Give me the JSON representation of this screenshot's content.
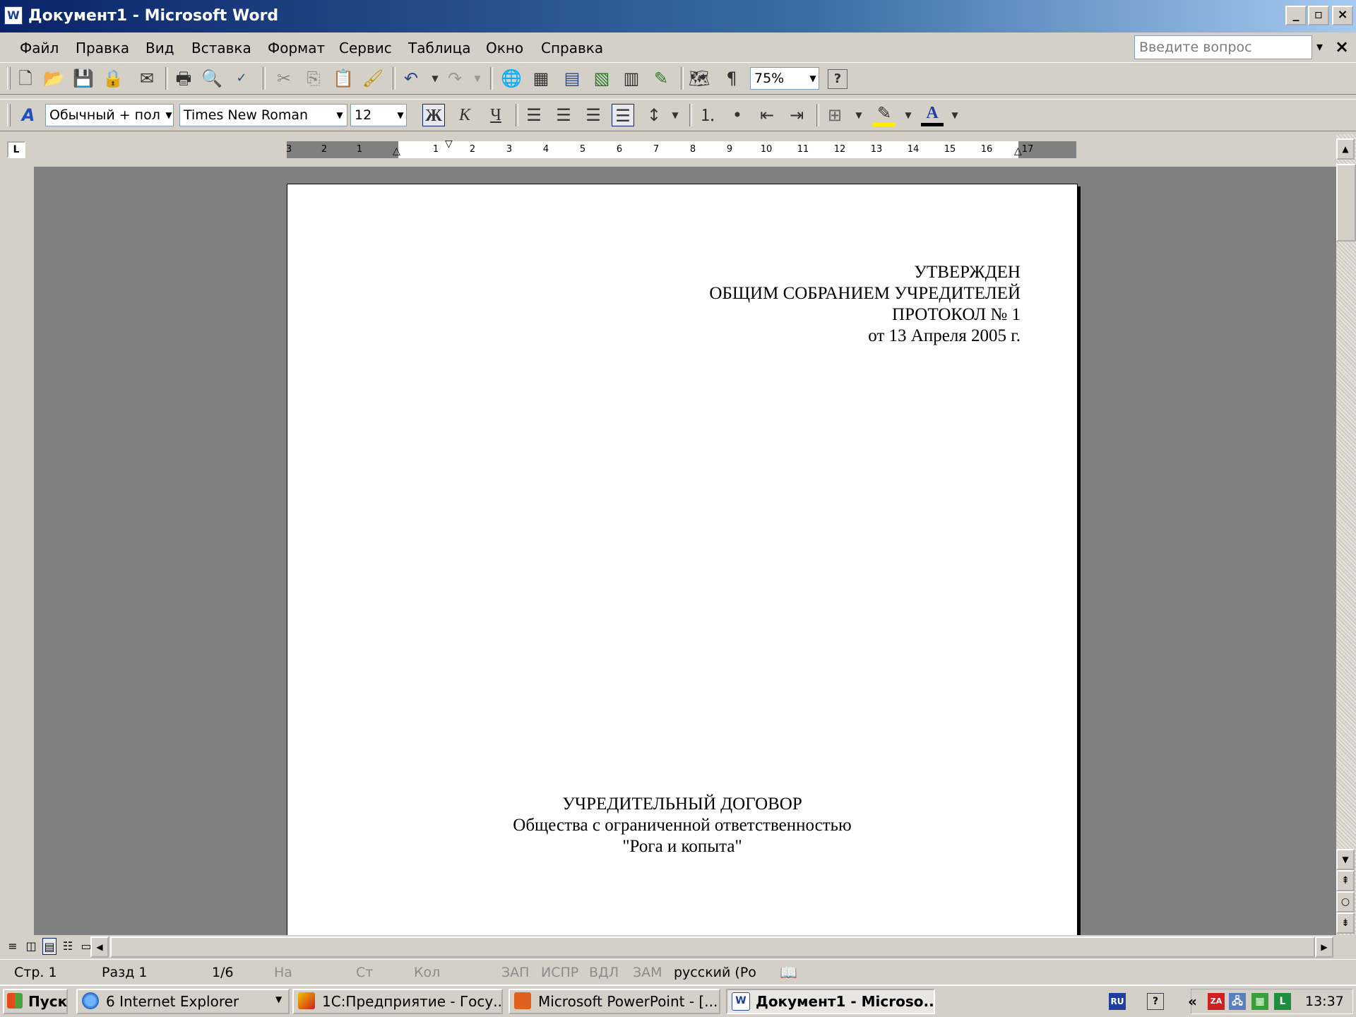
{
  "window": {
    "title": "Документ1 - Microsoft Word",
    "app_icon": "W",
    "controls": [
      "_",
      "▫",
      "×"
    ]
  },
  "menubar": {
    "items": [
      "Файл",
      "Правка",
      "Вид",
      "Вставка",
      "Формат",
      "Сервис",
      "Таблица",
      "Окно",
      "Справка"
    ],
    "help_placeholder": "Введите вопрос",
    "help_arrow": "▾",
    "close_doc": "×"
  },
  "standard_toolbar": {
    "zoom": "75%",
    "paragraph_mark": "¶",
    "help_glyph": "?"
  },
  "formatting_toolbar": {
    "style": "Обычный + пол",
    "font": "Times New Roman",
    "size": "12",
    "bold": "Ж",
    "italic": "К",
    "underline": "Ч",
    "font_color_glyph": "A"
  },
  "ruler": {
    "corner": "L",
    "numbers": [
      "3",
      "2",
      "1",
      "1",
      "2",
      "3",
      "4",
      "5",
      "6",
      "7",
      "8",
      "9",
      "10",
      "11",
      "12",
      "13",
      "14",
      "15",
      "16",
      "17"
    ]
  },
  "document": {
    "approval": [
      "УТВЕРЖДЕН",
      "ОБЩИМ СОБРАНИЕМ УЧРЕДИТЕЛЕЙ",
      "ПРОТОКОЛ № 1",
      "от 13 Апреля 2005 г."
    ],
    "heading": [
      "УЧРЕДИТЕЛЬНЫЙ ДОГОВОР",
      "Общества с ограниченной ответственностью",
      "\"Рога и копыта\""
    ]
  },
  "statusbar": {
    "page": "Стр. 1",
    "section": "Разд 1",
    "pages": "1/6",
    "at": "На",
    "line": "Ст",
    "col": "Кол",
    "rec": "ЗАП",
    "trk": "ИСПР",
    "ext": "ВДЛ",
    "ovr": "ЗАМ",
    "language": "русский (Ро"
  },
  "taskbar": {
    "start": "Пуск",
    "tasks": [
      {
        "label": "6 Internet Explorer"
      },
      {
        "label": "1С:Предприятие - Госу..."
      },
      {
        "label": "Microsoft PowerPoint - [..."
      },
      {
        "label": "Документ1 - Microso..."
      }
    ],
    "tray": {
      "lang": "RU",
      "time": "13:37",
      "chevron": "«"
    }
  },
  "colors": {
    "titlebar_start": "#0a246a",
    "titlebar_end": "#a6caf0",
    "workspace": "#808080",
    "chrome": "#d4d0c8"
  }
}
